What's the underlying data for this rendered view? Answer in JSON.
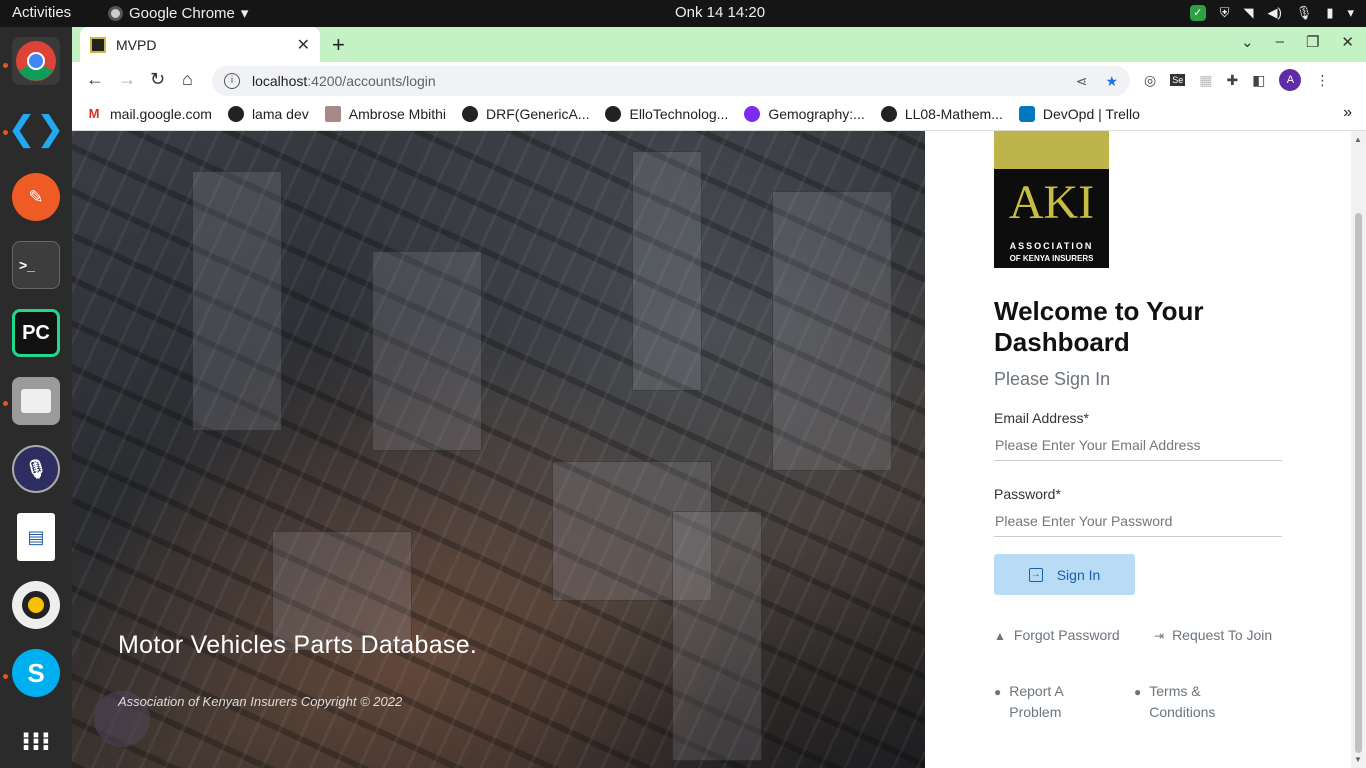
{
  "system": {
    "activities": "Activities",
    "app_name": "Google Chrome",
    "clock": "Onk 14  14:20"
  },
  "dock": {
    "apps": [
      "chrome-icon",
      "vscode-icon",
      "postman-icon",
      "terminal-icon",
      "pycharm-icon",
      "files-icon",
      "recorder-icon",
      "writer-icon",
      "rhythmbox-icon",
      "skype-icon",
      "app-grid-icon"
    ]
  },
  "browser": {
    "tab_title": "MVPD",
    "url_host": "localhost",
    "url_path": ":4200/accounts/login",
    "profile_initial": "A",
    "bookmarks": [
      "mail.google.com",
      "lama dev",
      "Ambrose Mbithi",
      "DRF(GenericA...",
      "ElloTechnolog...",
      "Gemography:...",
      "LL08-Mathem...",
      "DevOpd | Trello"
    ]
  },
  "hero": {
    "title": "Motor Vehicles Parts Database.",
    "copyright": "Association of Kenyan Insurers Copyright © 2022"
  },
  "logo": {
    "main": "AKI",
    "line1": "ASSOCIATION",
    "line2": "OF KENYA INSURERS"
  },
  "login": {
    "welcome": "Welcome to Your Dashboard",
    "subtitle": "Please Sign In",
    "email_label": "Email Address*",
    "email_placeholder": "Please Enter Your Email Address",
    "password_label": "Password*",
    "password_placeholder": "Please Enter Your Password",
    "signin_label": "Sign In",
    "forgot": "Forgot Password",
    "request": "Request To Join",
    "report": "Report A Problem",
    "terms": "Terms & Conditions"
  },
  "colors": {
    "tabstrip": "#c4f2c4",
    "button_bg": "#b8dcf5",
    "button_text": "#1a5fa8",
    "logo_gold": "#bdb54b"
  }
}
